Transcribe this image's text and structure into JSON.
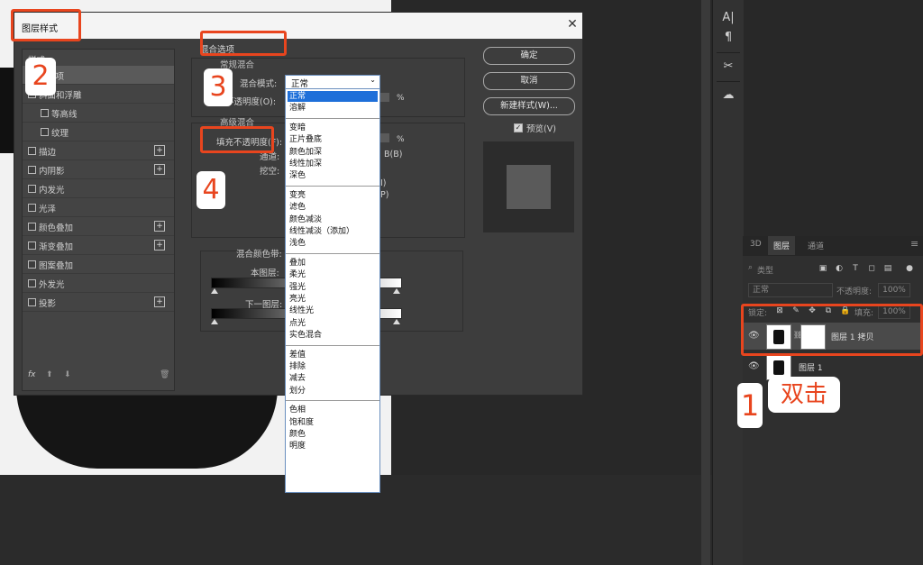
{
  "dialog": {
    "title": "图层样式",
    "close_glyph": "✕",
    "left_panel": {
      "header": "样式",
      "items": [
        {
          "label": "混合选项",
          "checkbox": false,
          "plus": false,
          "sub": false
        },
        {
          "label": "斜面和浮雕",
          "checkbox": true,
          "plus": false,
          "sub": false
        },
        {
          "label": "等高线",
          "checkbox": true,
          "plus": false,
          "sub": true
        },
        {
          "label": "纹理",
          "checkbox": true,
          "plus": false,
          "sub": true
        },
        {
          "label": "描边",
          "checkbox": true,
          "plus": true,
          "sub": false
        },
        {
          "label": "内阴影",
          "checkbox": true,
          "plus": true,
          "sub": false
        },
        {
          "label": "内发光",
          "checkbox": true,
          "plus": false,
          "sub": false
        },
        {
          "label": "光泽",
          "checkbox": true,
          "plus": false,
          "sub": false
        },
        {
          "label": "颜色叠加",
          "checkbox": true,
          "plus": true,
          "sub": false
        },
        {
          "label": "渐变叠加",
          "checkbox": true,
          "plus": true,
          "sub": false
        },
        {
          "label": "图案叠加",
          "checkbox": true,
          "plus": false,
          "sub": false
        },
        {
          "label": "外发光",
          "checkbox": true,
          "plus": false,
          "sub": false
        },
        {
          "label": "投影",
          "checkbox": true,
          "plus": true,
          "sub": false
        }
      ],
      "footer_fx": "fx"
    },
    "blending": {
      "section_title": "混合选项",
      "general_title": "常规混合",
      "blend_mode_label": "混合模式:",
      "blend_mode_value": "正常",
      "opacity_label": "不透明度(O):",
      "opacity_unit": "%",
      "advanced_title": "高级混合",
      "fill_opacity_label": "填充不透明度(F):",
      "fill_unit": "%",
      "channels_label": "通道:",
      "channels_b": "B(B)",
      "knockout_label": "挖空:",
      "knockout_i": "I)",
      "knockout_p": "P)",
      "blend_if_label": "混合颜色带:",
      "this_layer_label": "本图层:",
      "below_layer_label": "下一图层:"
    },
    "blend_modes": [
      {
        "group": [
          "正常",
          "溶解"
        ]
      },
      {
        "group": [
          "变暗",
          "正片叠底",
          "颜色加深",
          "线性加深",
          "深色"
        ]
      },
      {
        "group": [
          "变亮",
          "滤色",
          "颜色减淡",
          "线性减淡（添加）",
          "浅色"
        ]
      },
      {
        "group": [
          "叠加",
          "柔光",
          "强光",
          "亮光",
          "线性光",
          "点光",
          "实色混合"
        ]
      },
      {
        "group": [
          "差值",
          "排除",
          "减去",
          "划分"
        ]
      },
      {
        "group": [
          "色相",
          "饱和度",
          "颜色",
          "明度"
        ]
      }
    ],
    "buttons": {
      "ok": "确定",
      "cancel": "取消",
      "new_style": "新建样式(W)...",
      "preview_label": "预览(V)",
      "preview_checked": "✓"
    }
  },
  "layers_panel": {
    "tabs": [
      "3D",
      "图层",
      "通道"
    ],
    "filter_label": "类型",
    "blend_mode": "正常",
    "opacity_label": "不透明度:",
    "opacity_value": "100%",
    "lock_label": "锁定:",
    "fill_label": "填充:",
    "fill_value": "100%",
    "layers": [
      {
        "name": "图层 1 拷贝"
      },
      {
        "name": "图层 1"
      }
    ]
  },
  "annotations": {
    "n1": "1",
    "n2": "2",
    "n3": "3",
    "n4": "4",
    "double_click": "双击",
    "accent_color": "#e8451e"
  },
  "tools": {
    "icons": [
      "text-tool-icon",
      "paragraph-icon",
      "tools-icon",
      "libraries-icon"
    ],
    "glyphs": [
      "A|",
      "¶",
      "✂",
      "☁"
    ]
  }
}
